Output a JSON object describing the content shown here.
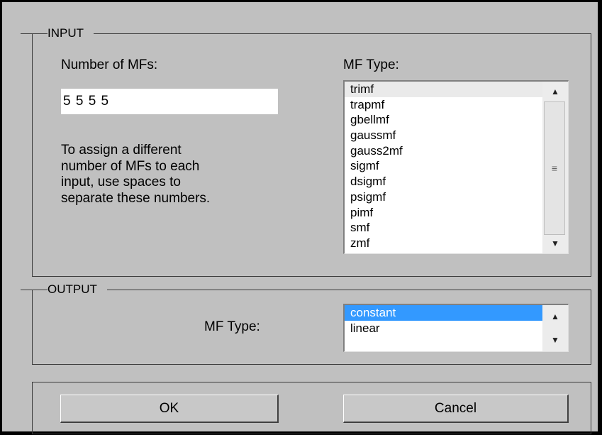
{
  "input": {
    "legend": "INPUT",
    "num_mfs_label": "Number of MFs:",
    "num_mfs_value": "5 5 5 5",
    "help_text": "To assign a different\nnumber of MFs to each\ninput, use spaces to\nseparate these numbers.",
    "mf_type_label": "MF Type:",
    "mf_types": [
      "trimf",
      "trapmf",
      "gbellmf",
      "gaussmf",
      "gauss2mf",
      "sigmf",
      "dsigmf",
      "psigmf",
      "pimf",
      "smf",
      "zmf"
    ],
    "focused_item": "trimf"
  },
  "output": {
    "legend": "OUTPUT",
    "mf_type_label": "MF Type:",
    "mf_types": [
      "constant",
      "linear"
    ],
    "selected_item": "constant"
  },
  "buttons": {
    "ok_label": "OK",
    "cancel_label": "Cancel"
  },
  "icons": {
    "scroll_up": "up-arrow-icon",
    "scroll_down": "down-arrow-icon",
    "scroll_grip": "grip-icon"
  },
  "colors": {
    "dialog_background": "#c0c0c0",
    "selection": "#3399ff"
  }
}
